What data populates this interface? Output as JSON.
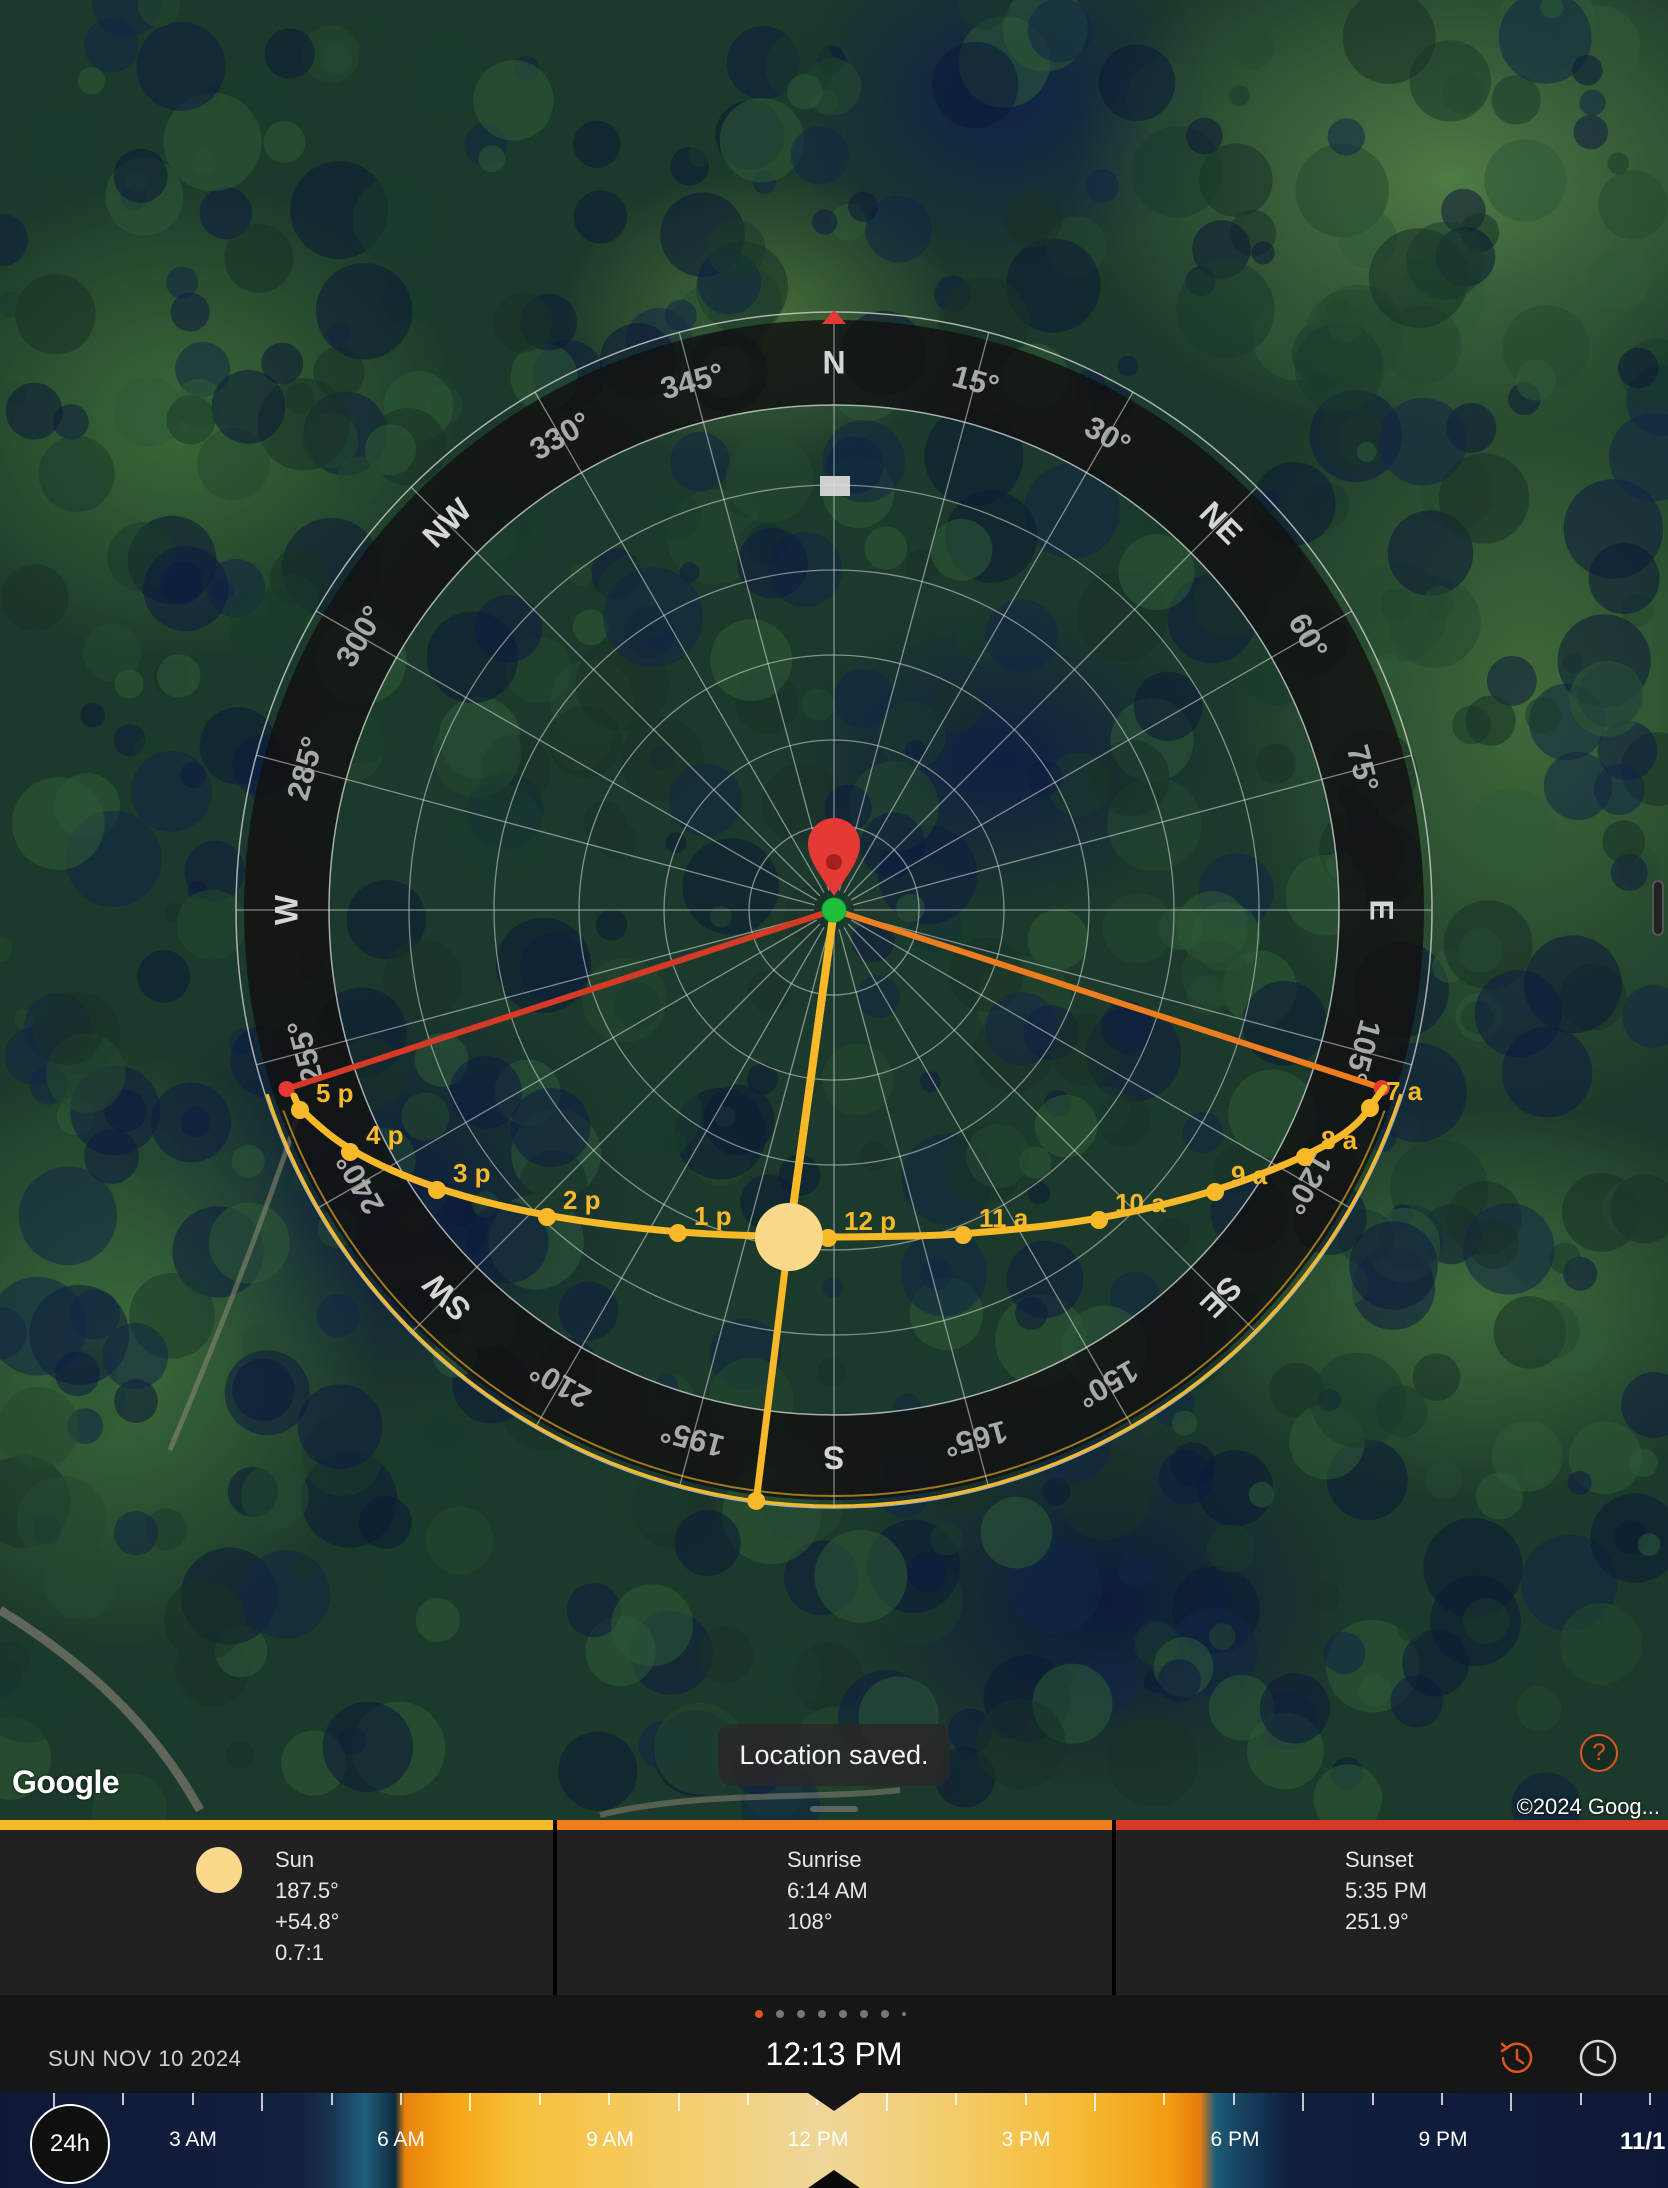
{
  "map": {
    "attribution_logo": "Google",
    "copyright": "©2024 Goog...",
    "toast": "Location saved.",
    "help_label": "?"
  },
  "compass": {
    "cardinals": {
      "N": "N",
      "NE": "NE",
      "E": "E",
      "SE": "SE",
      "S": "S",
      "SW": "SW",
      "W": "W",
      "NW": "NW"
    },
    "degree_labels": [
      "15°",
      "30°",
      "60°",
      "75°",
      "105°",
      "120°",
      "150°",
      "165°",
      "195°",
      "210°",
      "240°",
      "255°",
      "285°",
      "300°",
      "330°",
      "345°"
    ],
    "colors": {
      "sun_path": "#f7b928",
      "sunrise_line": "#ee7d1f",
      "sunset_line": "#d43a25",
      "sun_disc": "#fcd98a",
      "center_dot": "#1fbf3a",
      "pin": "#e53935"
    }
  },
  "sun_path_labels": [
    "5 p",
    "4 p",
    "3 p",
    "2 p",
    "1 p",
    "12 p",
    "11 a",
    "10 a",
    "9 a",
    "8 a",
    "7 a"
  ],
  "info_panel": {
    "bar_colors": [
      "#f7b928",
      "#ee7d1f",
      "#d43a25"
    ],
    "sun": {
      "title": "Sun",
      "azimuth": "187.5°",
      "elevation": "+54.8°",
      "shadow_ratio": "0.7:1"
    },
    "sunrise": {
      "title": "Sunrise",
      "time": "6:14 AM",
      "azimuth": "108°"
    },
    "sunset": {
      "title": "Sunset",
      "time": "5:35 PM",
      "azimuth": "251.9°"
    }
  },
  "pager": {
    "count": 8,
    "active_index": 0,
    "active_color": "#e0541f"
  },
  "toolbar": {
    "date": "SUN NOV 10 2024",
    "time": "12:13 PM",
    "history_icon": "history-clock-icon",
    "clock_icon": "clock-icon",
    "history_color": "#e0541f"
  },
  "timeline": {
    "toggle_label": "24h",
    "hour_labels": [
      "3 AM",
      "6 AM",
      "9 AM",
      "12 PM",
      "3 PM",
      "6 PM",
      "9 PM",
      "11/1"
    ]
  }
}
